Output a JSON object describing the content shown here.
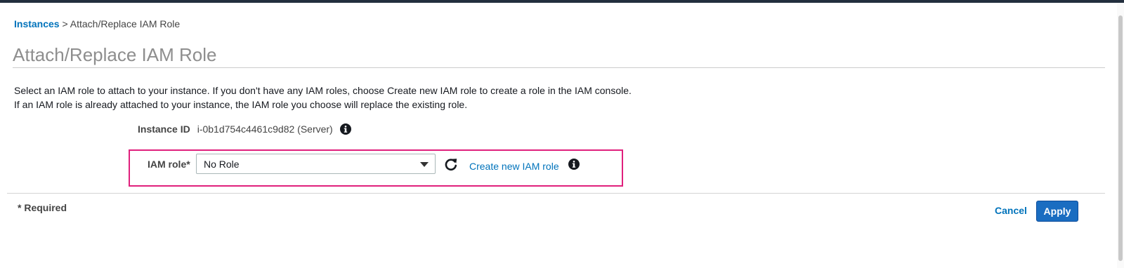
{
  "breadcrumb": {
    "link_label": "Instances",
    "separator": " > ",
    "current": "Attach/Replace IAM Role"
  },
  "page": {
    "title": "Attach/Replace IAM Role",
    "description_line1": "Select an IAM role to attach to your instance. If you don't have any IAM roles, choose Create new IAM role to create a role in the IAM console.",
    "description_line2": "If an IAM role is already attached to your instance, the IAM role you choose will replace the existing role."
  },
  "form": {
    "instance_label": "Instance ID",
    "instance_value": "i-0b1d754c4461c9d82 (Server)",
    "role_label": "IAM role*",
    "role_selected": "No Role",
    "create_role_link": "Create new IAM role"
  },
  "footer": {
    "required_note": "* Required",
    "cancel_label": "Cancel",
    "apply_label": "Apply"
  },
  "icons": {
    "info": "info-icon",
    "refresh": "refresh-icon",
    "dropdown": "caret-down-icon"
  },
  "colors": {
    "link": "#0073bb",
    "primary_button": "#1a6dc1",
    "highlight_border": "#e0207c",
    "top_bar": "#232f3e"
  }
}
